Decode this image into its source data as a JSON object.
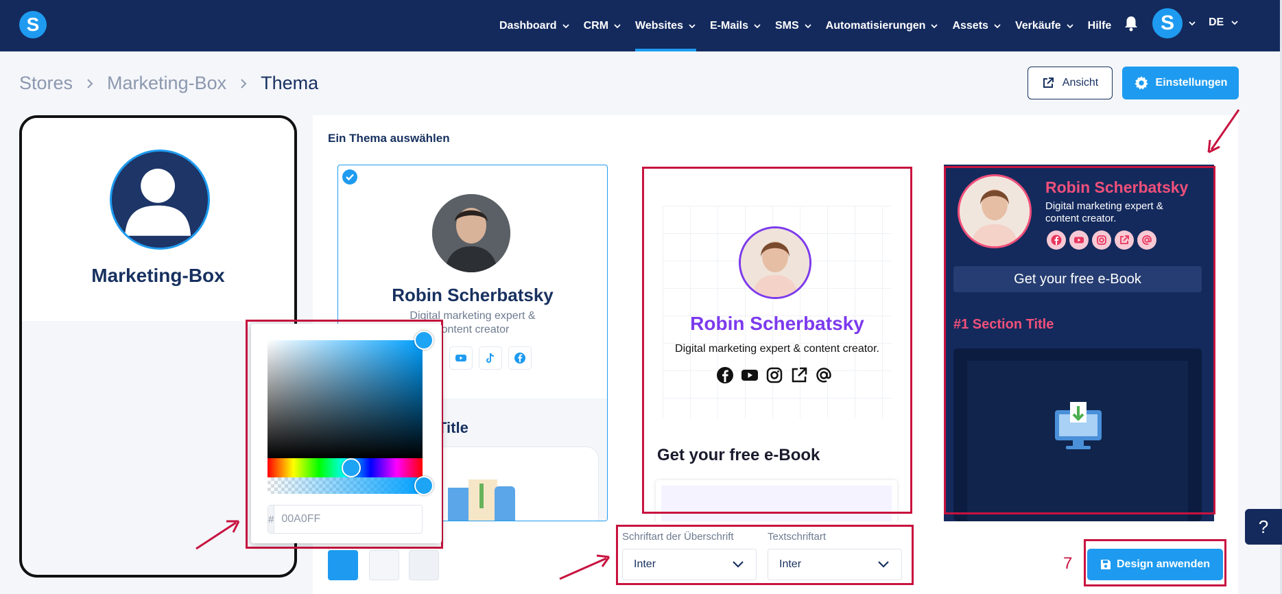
{
  "nav": {
    "logo": "S",
    "items": [
      {
        "label": "Dashboard",
        "active": false
      },
      {
        "label": "CRM",
        "active": false
      },
      {
        "label": "Websites",
        "active": true
      },
      {
        "label": "E-Mails",
        "active": false
      },
      {
        "label": "SMS",
        "active": false
      },
      {
        "label": "Automatisierungen",
        "active": false
      },
      {
        "label": "Assets",
        "active": false
      },
      {
        "label": "Verkäufe",
        "active": false
      }
    ],
    "help_label": "Hilfe",
    "avatar_letter": "S",
    "language": "DE"
  },
  "breadcrumb": [
    "Stores",
    "Marketing-Box",
    "Thema"
  ],
  "actions": {
    "view_label": "Ansicht",
    "settings_label": "Einstellungen"
  },
  "phone_preview": {
    "name": "Marketing-Box"
  },
  "theme_panel": {
    "title": "Ein Thema auswählen",
    "themes": [
      {
        "name": "Robin Scherbatsky",
        "subtitle_line1": "Digital marketing expert &",
        "subtitle_line2": "content creator",
        "section_title": "Title",
        "selected": true
      },
      {
        "name": "Robin Scherbatsky",
        "subtitle": "Digital marketing expert & content creator.",
        "ebook_title": "Get your free e-Book",
        "selected": false
      },
      {
        "name": "Robin Scherbatsky",
        "subtitle_line1": "Digital marketing expert &",
        "subtitle_line2": "content creator.",
        "ebook_button": "Get your free e-Book",
        "section_title": "#1 Section Title",
        "selected": false
      }
    ]
  },
  "color_picker": {
    "hash": "#",
    "hex_value": "00A0FF"
  },
  "swatches": [
    "#1e9bf0",
    "#f4f6fa",
    "#eef1f5"
  ],
  "fonts": {
    "heading_label": "Schriftart der Überschrift",
    "heading_value": "Inter",
    "body_label": "Textschriftart",
    "body_value": "Inter"
  },
  "step_number": "7",
  "apply_label": "Design anwenden",
  "help_button": "?"
}
